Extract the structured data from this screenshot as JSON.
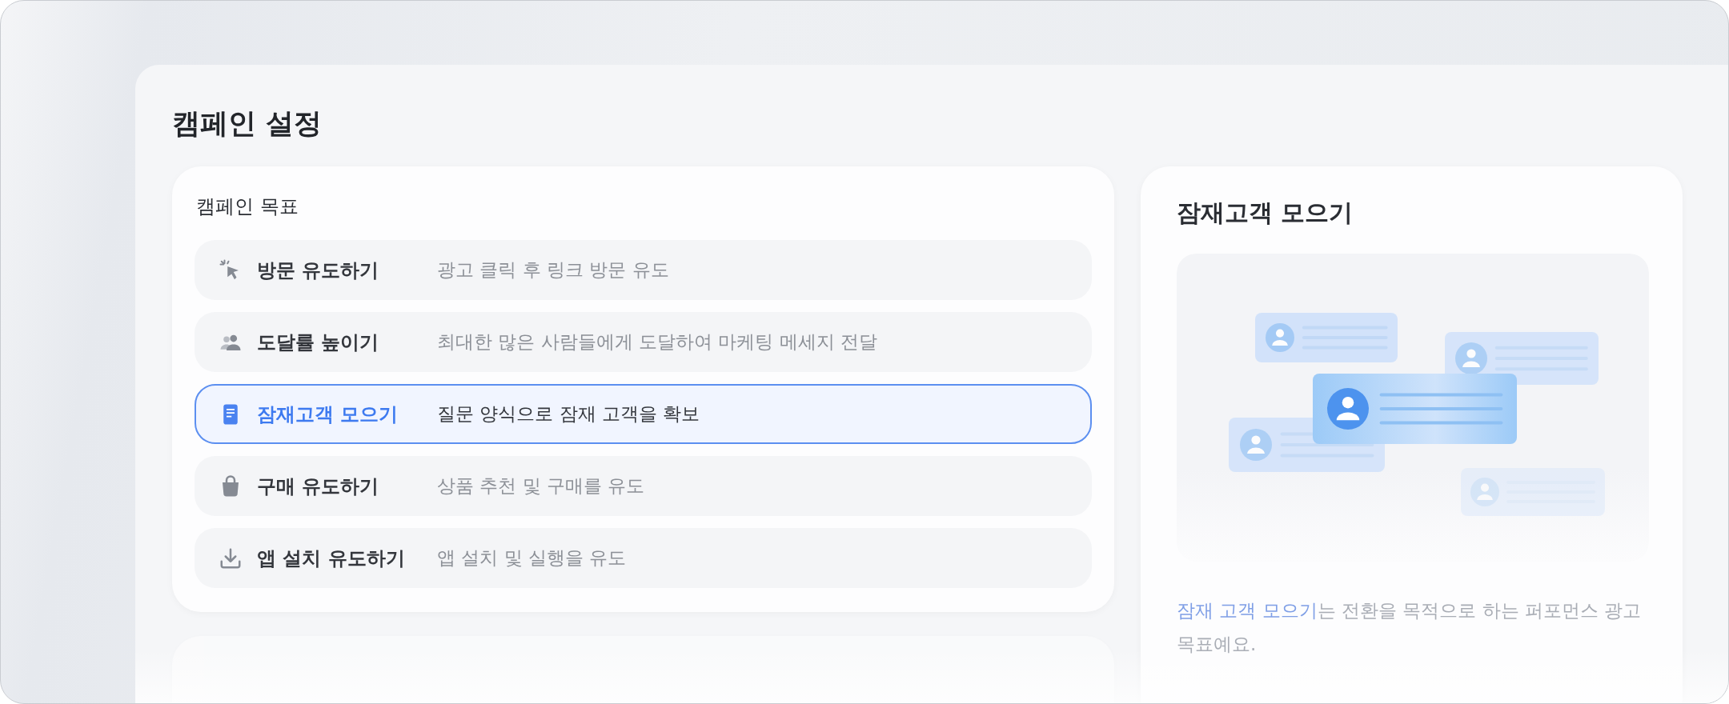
{
  "page_title": "캠페인 설정",
  "objective": {
    "label": "캠페인 목표",
    "items": [
      {
        "title": "방문 유도하기",
        "description": "광고 클릭 후 링크 방문 유도",
        "selected": false
      },
      {
        "title": "도달률 높이기",
        "description": "최대한 많은 사람들에게 도달하여 마케팅 메세지 전달",
        "selected": false
      },
      {
        "title": "잠재고객 모으기",
        "description": "질문 양식으로 잠재 고객을 확보",
        "selected": true
      },
      {
        "title": "구매 유도하기",
        "description": "상품 추천 및 구매를 유도",
        "selected": false
      },
      {
        "title": "앱 설치 유도하기",
        "description": "앱 설치 및 실행을 유도",
        "selected": false
      }
    ]
  },
  "detail": {
    "title": "잠재고객 모으기",
    "description": "**잠재 고객 모으기**는 전환을 목적으로 하는 퍼포먼스 광고 목표예요."
  }
}
